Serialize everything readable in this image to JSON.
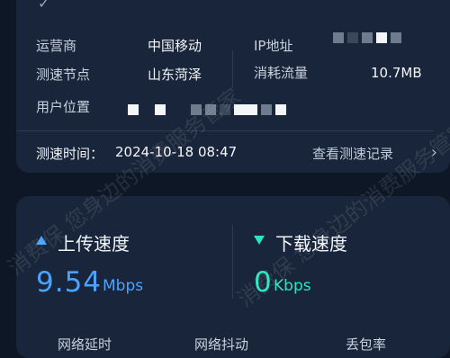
{
  "info": {
    "carrier_label": "运营商",
    "carrier_value": "中国移动",
    "ip_label": "IP地址",
    "node_label": "测速节点",
    "node_value": "山东菏泽",
    "traffic_label": "消耗流量",
    "traffic_value": "10.7MB",
    "location_label": "用户位置",
    "test_time_label": "测速时间：",
    "test_time_value": "2024-10-18 08:47",
    "history_link": "查看测速记录"
  },
  "speed": {
    "upload_title": "上传速度",
    "upload_value": "9.54",
    "upload_unit": "Mbps",
    "download_title": "下载速度",
    "download_value": "0",
    "download_unit": "Kbps"
  },
  "bottom_tabs": [
    "网络延时",
    "网络抖动",
    "丢包率"
  ],
  "watermark_text": "消费保 您身边的消费服务管家",
  "colors": {
    "background": "#0d1726",
    "card": "#19253a",
    "upload_accent": "#4ba3ff",
    "download_accent": "#29e6c2"
  }
}
